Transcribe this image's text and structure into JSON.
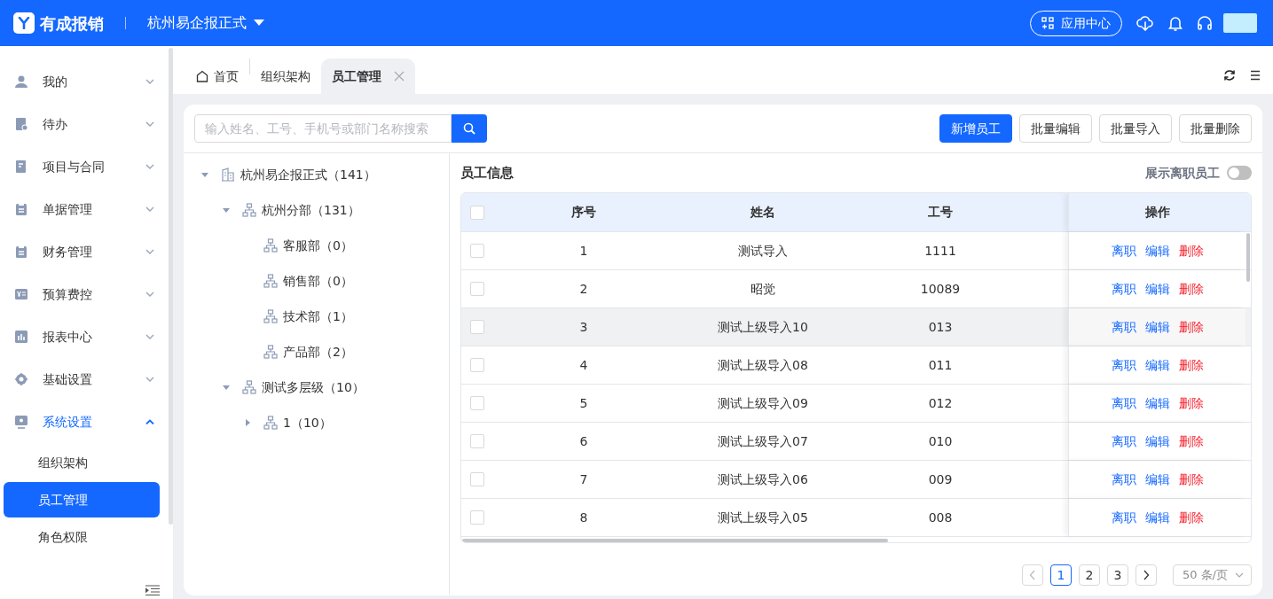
{
  "header": {
    "logo_text": "有成报销",
    "company": "杭州易企报正式",
    "app_center": "应用中心"
  },
  "sidebar": {
    "items": [
      {
        "label": "我的",
        "expanded": false,
        "selected": false
      },
      {
        "label": "待办",
        "expanded": false,
        "selected": false
      },
      {
        "label": "项目与合同",
        "expanded": false,
        "selected": false
      },
      {
        "label": "单据管理",
        "expanded": false,
        "selected": false
      },
      {
        "label": "财务管理",
        "expanded": false,
        "selected": false
      },
      {
        "label": "预算费控",
        "expanded": false,
        "selected": false
      },
      {
        "label": "报表中心",
        "expanded": false,
        "selected": false
      },
      {
        "label": "基础设置",
        "expanded": false,
        "selected": false
      },
      {
        "label": "系统设置",
        "expanded": true,
        "selected": true,
        "children": [
          {
            "label": "组织架构",
            "selected": false
          },
          {
            "label": "员工管理",
            "selected": true
          },
          {
            "label": "角色权限",
            "selected": false
          }
        ]
      }
    ]
  },
  "tabs": [
    {
      "label": "首页",
      "selected": false,
      "closable": false
    },
    {
      "label": "组织架构",
      "selected": false,
      "closable": false
    },
    {
      "label": "员工管理",
      "selected": true,
      "closable": true
    }
  ],
  "toolbar": {
    "search": {
      "placeholder": "输入姓名、工号、手机号或部门名称搜索"
    },
    "buttons": [
      {
        "label": "新增员工",
        "primary": true
      },
      {
        "label": "批量编辑",
        "primary": false
      },
      {
        "label": "批量导入",
        "primary": false
      },
      {
        "label": "批量删除",
        "primary": false
      }
    ]
  },
  "tree": [
    {
      "label": "杭州易企报正式（141）",
      "kind": "company",
      "expanded": true,
      "children": [
        {
          "label": "杭州分部（131）",
          "kind": "dept",
          "expanded": true,
          "children": [
            {
              "label": "客服部（0）",
              "kind": "dept"
            },
            {
              "label": "销售部（0）",
              "kind": "dept"
            },
            {
              "label": "技术部（1）",
              "kind": "dept"
            },
            {
              "label": "产品部（2）",
              "kind": "dept"
            }
          ]
        },
        {
          "label": "测试多层级（10）",
          "kind": "dept",
          "expanded": true,
          "children": [
            {
              "label": "1（10）",
              "kind": "dept",
              "expanded": false
            }
          ]
        }
      ]
    }
  ],
  "employees": {
    "title": "员工信息",
    "show_resigned": {
      "label": "展示离职员工",
      "on": false
    },
    "columns": [
      "序号",
      "姓名",
      "工号",
      "操作"
    ],
    "all_checked": false,
    "rows": [
      {
        "cells": [
          "1",
          "测试导入",
          "1111"
        ],
        "checked": false,
        "hovered": false,
        "actions": [
          {
            "label": "离职",
            "kind": "link"
          },
          {
            "label": "编辑",
            "kind": "link"
          },
          {
            "label": "删除",
            "kind": "danger"
          }
        ]
      },
      {
        "cells": [
          "2",
          "昭觉",
          "10089"
        ],
        "checked": false,
        "hovered": false,
        "actions": [
          {
            "label": "离职",
            "kind": "link"
          },
          {
            "label": "编辑",
            "kind": "link"
          },
          {
            "label": "删除",
            "kind": "danger"
          }
        ]
      },
      {
        "cells": [
          "3",
          "测试上级导入10",
          "013"
        ],
        "checked": false,
        "hovered": true,
        "actions": [
          {
            "label": "离职",
            "kind": "link"
          },
          {
            "label": "编辑",
            "kind": "link"
          },
          {
            "label": "删除",
            "kind": "danger"
          }
        ]
      },
      {
        "cells": [
          "4",
          "测试上级导入08",
          "011"
        ],
        "checked": false,
        "hovered": false,
        "actions": [
          {
            "label": "离职",
            "kind": "link"
          },
          {
            "label": "编辑",
            "kind": "link"
          },
          {
            "label": "删除",
            "kind": "danger"
          }
        ]
      },
      {
        "cells": [
          "5",
          "测试上级导入09",
          "012"
        ],
        "checked": false,
        "hovered": false,
        "actions": [
          {
            "label": "离职",
            "kind": "link"
          },
          {
            "label": "编辑",
            "kind": "link"
          },
          {
            "label": "删除",
            "kind": "danger"
          }
        ]
      },
      {
        "cells": [
          "6",
          "测试上级导入07",
          "010"
        ],
        "checked": false,
        "hovered": false,
        "actions": [
          {
            "label": "离职",
            "kind": "link"
          },
          {
            "label": "编辑",
            "kind": "link"
          },
          {
            "label": "删除",
            "kind": "danger"
          }
        ]
      },
      {
        "cells": [
          "7",
          "测试上级导入06",
          "009"
        ],
        "checked": false,
        "hovered": false,
        "actions": [
          {
            "label": "离职",
            "kind": "link"
          },
          {
            "label": "编辑",
            "kind": "link"
          },
          {
            "label": "删除",
            "kind": "danger"
          }
        ]
      },
      {
        "cells": [
          "8",
          "测试上级导入05",
          "008"
        ],
        "checked": false,
        "hovered": false,
        "actions": [
          {
            "label": "离职",
            "kind": "link"
          },
          {
            "label": "编辑",
            "kind": "link"
          },
          {
            "label": "删除",
            "kind": "danger"
          }
        ]
      }
    ],
    "pagination": {
      "pages": [
        {
          "label": "1",
          "selected": true
        },
        {
          "label": "2",
          "selected": false
        },
        {
          "label": "3",
          "selected": false
        }
      ],
      "page_size": "50 条/页"
    }
  }
}
